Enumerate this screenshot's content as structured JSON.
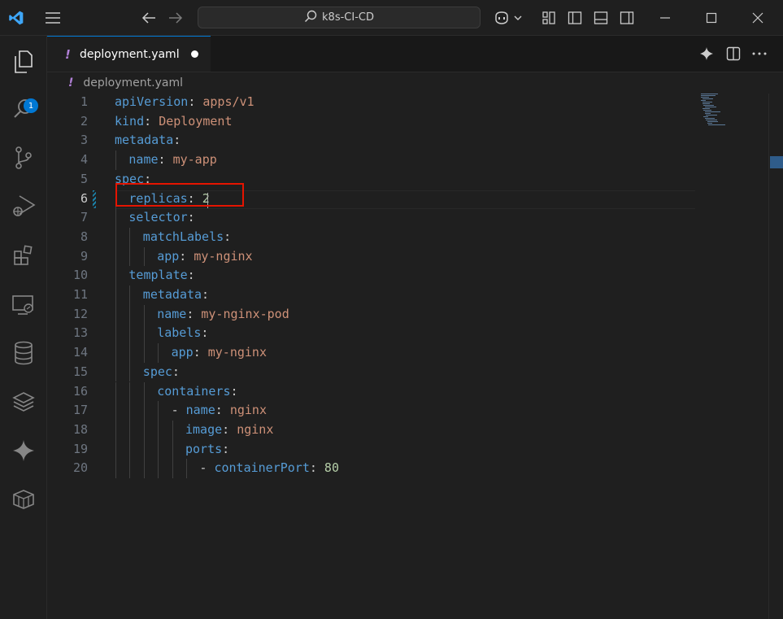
{
  "titlebar": {
    "search_text": "k8s-CI-CD",
    "icons": [
      "vscode-logo-icon",
      "menu-icon",
      "back-arrow-icon",
      "forward-arrow-icon",
      "search-icon",
      "copilot-icon",
      "chevron-down-icon",
      "customize-layout-icon",
      "toggle-primary-sidebar-icon",
      "toggle-panel-icon",
      "toggle-secondary-sidebar-icon",
      "minimize-icon",
      "maximize-icon",
      "close-icon"
    ]
  },
  "activitybar": {
    "explorer_badge": "1",
    "items": [
      "explorer-icon",
      "search-icon",
      "source-control-icon",
      "run-debug-icon",
      "extensions-icon",
      "remote-explorer-icon",
      "database-icon",
      "layers-icon",
      "sparkle-icon",
      "container-icon"
    ]
  },
  "tab": {
    "marker": "!",
    "filename": "deployment.yaml"
  },
  "breadcrumb": {
    "marker": "!",
    "filename": "deployment.yaml"
  },
  "editor": {
    "active_line": 6,
    "lines": [
      {
        "num": "1",
        "indent": 0,
        "key": "apiVersion",
        "sep": ": ",
        "val": "apps/v1",
        "vtype": "s"
      },
      {
        "num": "2",
        "indent": 0,
        "key": "kind",
        "sep": ": ",
        "val": "Deployment",
        "vtype": "s"
      },
      {
        "num": "3",
        "indent": 0,
        "key": "metadata",
        "sep": ":",
        "val": "",
        "vtype": "s"
      },
      {
        "num": "4",
        "indent": 1,
        "key": "name",
        "sep": ": ",
        "val": "my-app",
        "vtype": "s"
      },
      {
        "num": "5",
        "indent": 0,
        "key": "spec",
        "sep": ":",
        "val": "",
        "vtype": "s"
      },
      {
        "num": "6",
        "indent": 1,
        "key": "replicas",
        "sep": ": ",
        "val": "2",
        "vtype": "n"
      },
      {
        "num": "7",
        "indent": 1,
        "key": "selector",
        "sep": ":",
        "val": "",
        "vtype": "s"
      },
      {
        "num": "8",
        "indent": 2,
        "key": "matchLabels",
        "sep": ":",
        "val": "",
        "vtype": "s"
      },
      {
        "num": "9",
        "indent": 3,
        "key": "app",
        "sep": ": ",
        "val": "my-nginx",
        "vtype": "s"
      },
      {
        "num": "10",
        "indent": 1,
        "key": "template",
        "sep": ":",
        "val": "",
        "vtype": "s"
      },
      {
        "num": "11",
        "indent": 2,
        "key": "metadata",
        "sep": ":",
        "val": "",
        "vtype": "s"
      },
      {
        "num": "12",
        "indent": 3,
        "key": "name",
        "sep": ": ",
        "val": "my-nginx-pod",
        "vtype": "s"
      },
      {
        "num": "13",
        "indent": 3,
        "key": "labels",
        "sep": ":",
        "val": "",
        "vtype": "s"
      },
      {
        "num": "14",
        "indent": 4,
        "key": "app",
        "sep": ": ",
        "val": "my-nginx",
        "vtype": "s"
      },
      {
        "num": "15",
        "indent": 2,
        "key": "spec",
        "sep": ":",
        "val": "",
        "vtype": "s"
      },
      {
        "num": "16",
        "indent": 3,
        "key": "containers",
        "sep": ":",
        "val": "",
        "vtype": "s"
      },
      {
        "num": "17",
        "indent": 4,
        "dash": "- ",
        "key": "name",
        "sep": ": ",
        "val": "nginx",
        "vtype": "s"
      },
      {
        "num": "18",
        "indent": 5,
        "key": "image",
        "sep": ": ",
        "val": "nginx",
        "vtype": "s"
      },
      {
        "num": "19",
        "indent": 5,
        "key": "ports",
        "sep": ":",
        "val": "",
        "vtype": "s"
      },
      {
        "num": "20",
        "indent": 6,
        "dash": "- ",
        "key": "containerPort",
        "sep": ": ",
        "val": "80",
        "vtype": "n"
      }
    ]
  },
  "colors": {
    "accent": "#0078d4",
    "highlight_box": "#e51400",
    "yaml_key": "#569cd6",
    "yaml_string": "#ce9178",
    "yaml_number": "#b5cea8"
  }
}
